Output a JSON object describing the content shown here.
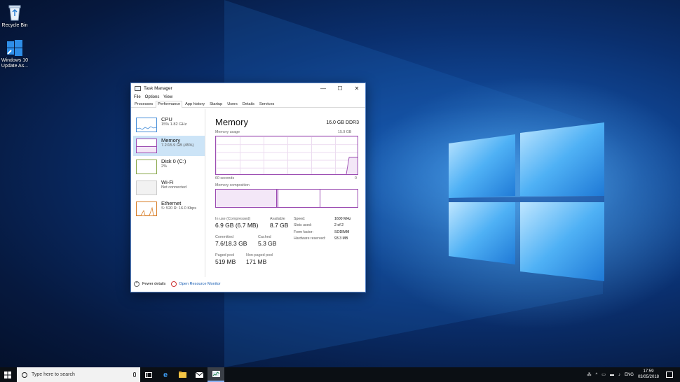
{
  "desktop": {
    "icons": [
      {
        "label": "Recycle Bin",
        "icon": "recycle-bin-icon"
      },
      {
        "label_lines": [
          "Windows 10",
          "Update As..."
        ],
        "icon": "windows-update-icon"
      }
    ]
  },
  "task_manager": {
    "title": "Task Manager",
    "controls": {
      "minimize": "—",
      "maximize": "☐",
      "close": "✕"
    },
    "menu": [
      "File",
      "Options",
      "View"
    ],
    "tabs": [
      "Processes",
      "Performance",
      "App history",
      "Startup",
      "Users",
      "Details",
      "Services"
    ],
    "active_tab": "Performance",
    "resources": [
      {
        "name": "CPU",
        "detail": "15% 1.82 GHz",
        "color": "#4a90d9"
      },
      {
        "name": "Memory",
        "detail": "7.2/15.9 GB (45%)",
        "color": "#9b4cb2",
        "selected": true
      },
      {
        "name": "Disk 0 (C:)",
        "detail": "2%",
        "color": "#6b8e23"
      },
      {
        "name": "Wi-Fi",
        "detail": "Not connected",
        "color": "#aaaaaa"
      },
      {
        "name": "Ethernet",
        "detail": "S: 520 R: 16.0 Kbps",
        "color": "#d87f2a"
      }
    ],
    "memory": {
      "heading": "Memory",
      "capacity": "16.0 GB DDR3",
      "usage_label": "Memory usage",
      "usage_max": "15.9 GB",
      "time_label": "60 seconds",
      "time_end": "0",
      "composition_label": "Memory composition",
      "composition": {
        "in_use": 0.43,
        "modified": 0.01,
        "standby": 0.3,
        "free": 0.26
      },
      "stats": {
        "in_use_label": "In use (Compressed)",
        "in_use_value": "6.9 GB (6.7 MB)",
        "available_label": "Available",
        "available_value": "8.7 GB",
        "committed_label": "Committed",
        "committed_value": "7.6/18.3 GB",
        "cached_label": "Cached",
        "cached_value": "5.3 GB",
        "paged_label": "Paged pool",
        "paged_value": "519 MB",
        "nonpaged_label": "Non-paged pool",
        "nonpaged_value": "171 MB"
      },
      "specs": [
        {
          "key": "Speed:",
          "value": "1600 MHz"
        },
        {
          "key": "Slots used:",
          "value": "2 of 2"
        },
        {
          "key": "Form factor:",
          "value": "SODIMM"
        },
        {
          "key": "Hardware reserved:",
          "value": "93.3 MB"
        }
      ]
    },
    "footer": {
      "fewer_details": "Fewer details",
      "resource_monitor": "Open Resource Monitor"
    }
  },
  "taskbar": {
    "search_placeholder": "Type here to search",
    "apps": [
      "task-view-icon",
      "edge-icon",
      "file-explorer-icon",
      "mail-icon",
      "task-manager-icon"
    ],
    "language": "ENG",
    "time": "17:59",
    "date": "03/05/2018"
  }
}
